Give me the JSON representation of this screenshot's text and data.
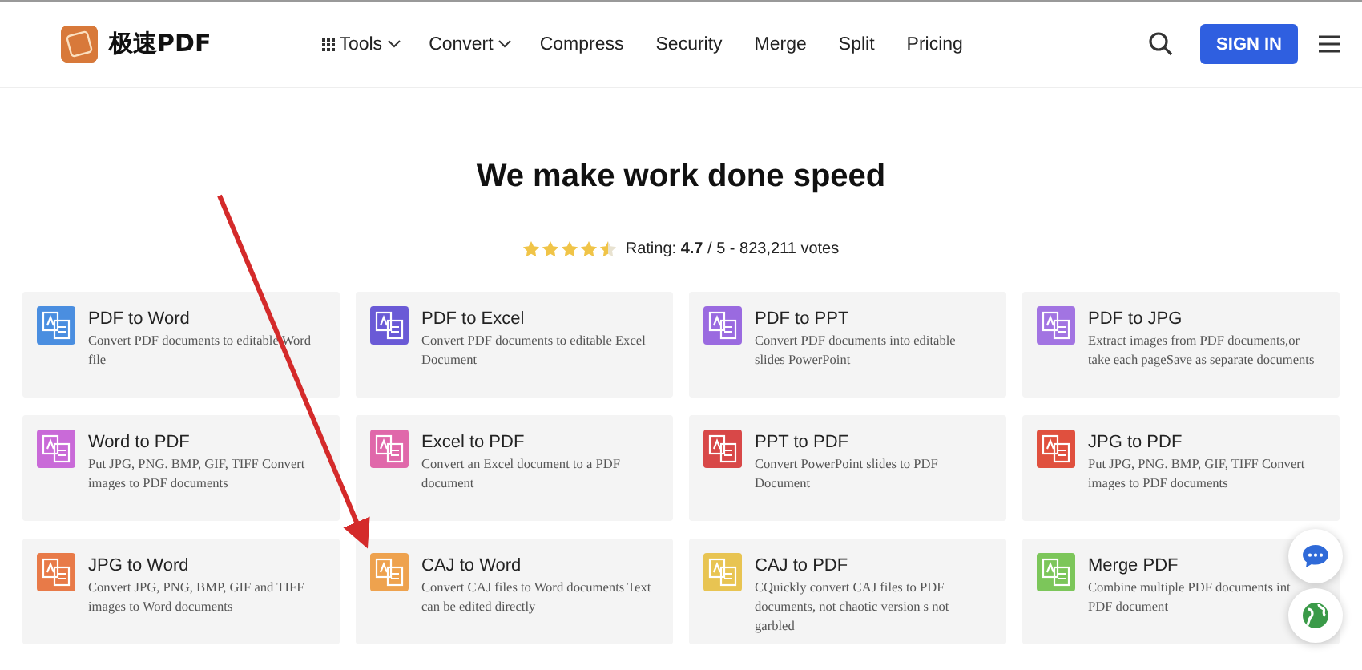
{
  "header": {
    "brand": "极速PDF",
    "nav": [
      {
        "label": "Tools",
        "kind": "grid-menu"
      },
      {
        "label": "Convert",
        "kind": "menu"
      },
      {
        "label": "Compress",
        "kind": "link"
      },
      {
        "label": "Security",
        "kind": "link"
      },
      {
        "label": "Merge",
        "kind": "link"
      },
      {
        "label": "Split",
        "kind": "link"
      },
      {
        "label": "Pricing",
        "kind": "link"
      }
    ],
    "sign_in": "SIGN IN"
  },
  "hero": {
    "title": "We make work done speed",
    "stars": 4.5,
    "rating": "Rating: **4.7** / 5 - 823,211 votes"
  },
  "tools": [
    {
      "title": "PDF to Word",
      "description": "Convert PDF documents to editable Word\nfile",
      "color": "#4a8ee0"
    },
    {
      "title": "PDF to Excel",
      "description": "Convert PDF documents to editable Excel\nDocument",
      "color": "#6a5ad6"
    },
    {
      "title": "PDF to PPT",
      "description": "Convert PDF documents into editable\nslides PowerPoint",
      "color": "#9a6ae0"
    },
    {
      "title": "PDF to JPG",
      "description": "Extract images from PDF documents,or\ntake each pageSave as separate documents",
      "color": "#a274e2"
    },
    {
      "title": "Word to PDF",
      "description": "Put JPG, PNG. BMP, GIF, TIFF Convert\nimages to PDF documents",
      "color": "#c96ad8"
    },
    {
      "title": "Excel to PDF",
      "description": "Convert an Excel document to a PDF\ndocument",
      "color": "#e068aa"
    },
    {
      "title": "PPT to PDF",
      "description": "Convert PowerPoint slides to PDF\nDocument",
      "color": "#d84848"
    },
    {
      "title": "JPG to PDF",
      "description": "Put JPG, PNG. BMP, GIF, TIFF Convert\nimages to PDF documents",
      "color": "#e0503e"
    },
    {
      "title": "JPG to Word",
      "description": "Convert JPG, PNG, BMP, GIF and TIFF\nimages to Word documents",
      "color": "#e87a48"
    },
    {
      "title": "CAJ to Word",
      "description": "Convert CAJ files to Word documents Text\ncan be edited directly",
      "color": "#eea24e"
    },
    {
      "title": "CAJ to PDF",
      "description": "CQuickly convert CAJ files to PDF\ndocuments, not chaotic version s not\ngarbled",
      "color": "#e8c452"
    },
    {
      "title": "Merge PDF",
      "description": "Combine multiple PDF documents int\nPDF document",
      "color": "#7cc65a"
    }
  ]
}
